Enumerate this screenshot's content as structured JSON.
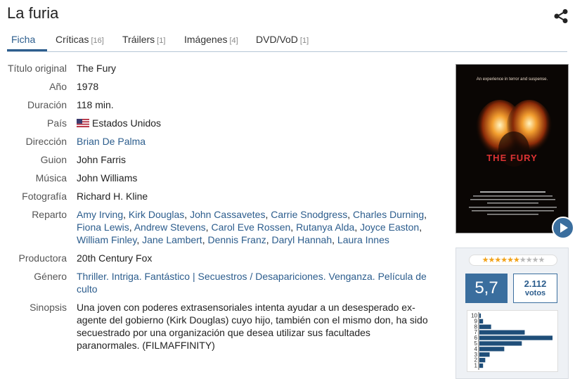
{
  "title": "La furia",
  "tabs": [
    {
      "label": "Ficha",
      "count": ""
    },
    {
      "label": "Críticas",
      "count": "[16]"
    },
    {
      "label": "Tráilers",
      "count": "[1]"
    },
    {
      "label": "Imágenes",
      "count": "[4]"
    },
    {
      "label": "DVD/VoD",
      "count": "[1]"
    }
  ],
  "details": {
    "original_title": {
      "label": "Título original",
      "value": "The Fury"
    },
    "year": {
      "label": "Año",
      "value": "1978"
    },
    "duration": {
      "label": "Duración",
      "value": "118 min."
    },
    "country": {
      "label": "País",
      "value": "Estados Unidos"
    },
    "director": {
      "label": "Dirección",
      "value": "Brian De Palma"
    },
    "screenplay": {
      "label": "Guion",
      "value": "John Farris"
    },
    "music": {
      "label": "Música",
      "value": "John Williams"
    },
    "photography": {
      "label": "Fotografía",
      "value": "Richard H. Kline"
    },
    "cast": {
      "label": "Reparto",
      "names": [
        "Amy Irving",
        "Kirk Douglas",
        "John Cassavetes",
        "Carrie Snodgress",
        "Charles Durning",
        "Fiona Lewis",
        "Andrew Stevens",
        "Carol Eve Rossen",
        "Rutanya Alda",
        "Joyce Easton",
        "William Finley",
        "Jane Lambert",
        "Dennis Franz",
        "Daryl Hannah",
        "Laura Innes"
      ]
    },
    "producer": {
      "label": "Productora",
      "value": "20th Century Fox"
    },
    "genre": {
      "label": "Género",
      "group1": [
        "Thriller",
        "Intriga",
        "Fantástico"
      ],
      "group2": [
        "Secuestros / Desapariciones",
        "Venganza",
        "Película de culto"
      ]
    },
    "synopsis": {
      "label": "Sinopsis",
      "text": "Una joven con poderes extrasensoriales intenta ayudar a un desesperado ex-agente del gobierno (Kirk Douglas) cuyo hijo, también con el mismo don, ha sido secuestrado por una organización que desea utilizar sus facultades paranormales. (FILMAFFINITY)"
    }
  },
  "poster": {
    "tagline": "An experience in terror and suspense.",
    "title_art": "THE FURY"
  },
  "rating": {
    "score": "5,7",
    "stars_filled": 6,
    "stars_total": 10,
    "votes": "2.112",
    "votes_label": "votos",
    "histogram": {
      "levels": [
        "10",
        "9",
        "8",
        "7",
        "6",
        "5",
        "4",
        "3",
        "2",
        "1"
      ],
      "shares": [
        0.02,
        0.05,
        0.16,
        0.62,
        1.0,
        0.58,
        0.34,
        0.14,
        0.08,
        0.05
      ]
    }
  },
  "colors": {
    "accent": "#2c5d8d",
    "score_bg": "#3a6e9e",
    "star_on": "#f2a31a"
  }
}
